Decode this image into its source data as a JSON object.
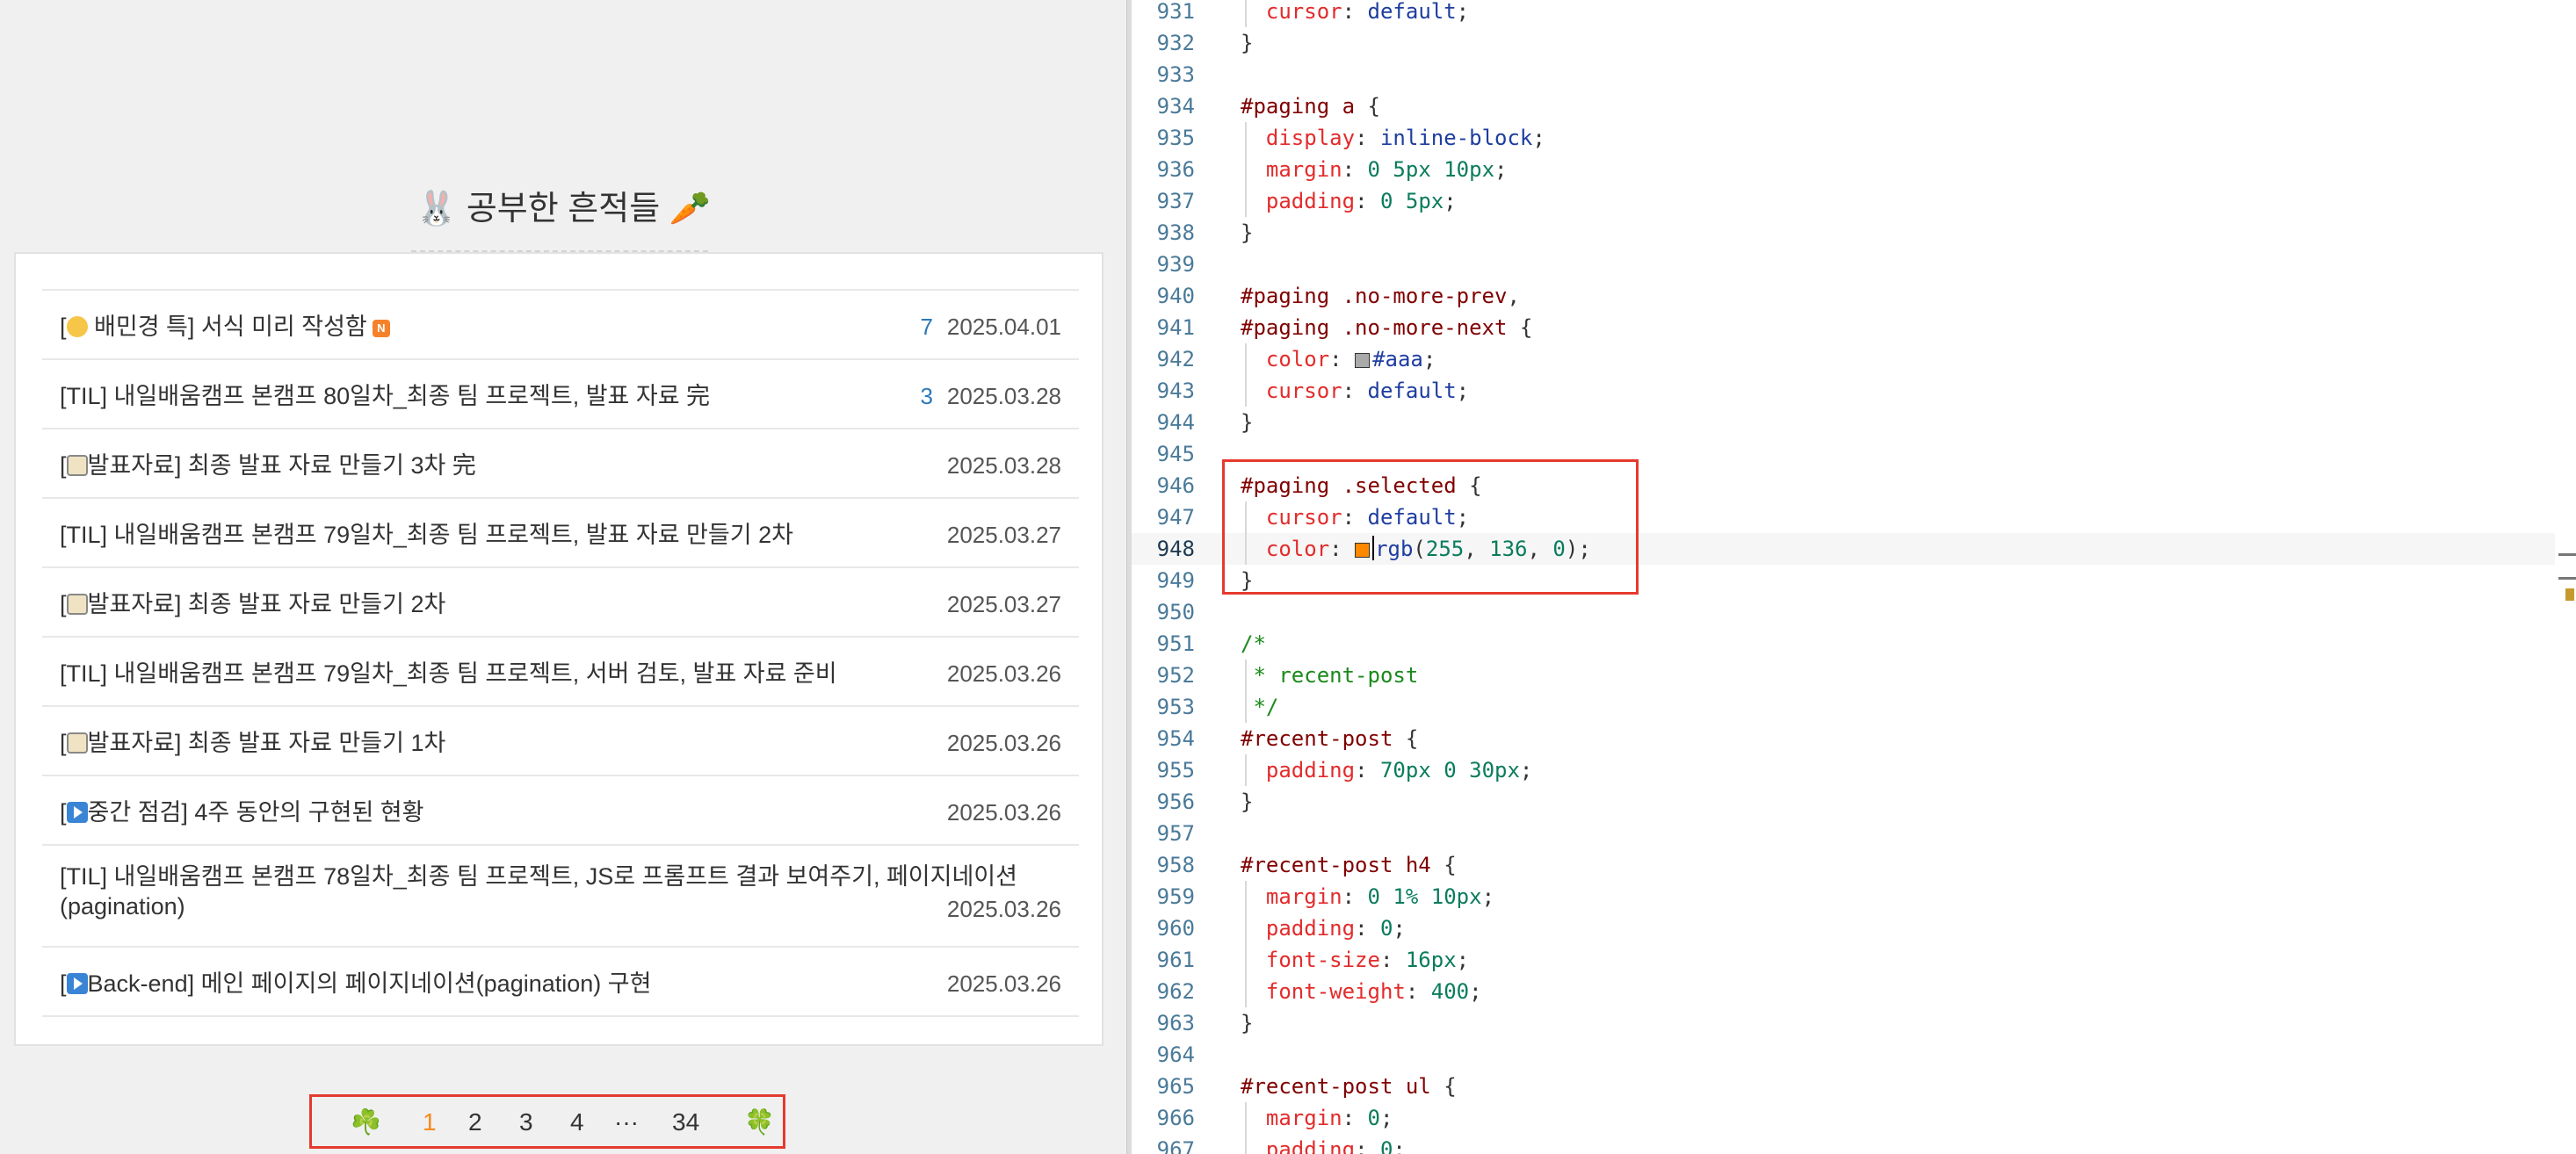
{
  "blog": {
    "section_title": "🐰 공부한 흔적들 🥕",
    "posts": [
      {
        "prefix": "[",
        "emoji": "silly-face",
        "title": " 배민경 특] 서식 미리 작성함",
        "new_badge": "N",
        "count": "7",
        "date": "2025.04.01"
      },
      {
        "prefix": "[TIL] 내일배움캠프 본캠프 80일차_최종 팀 프로젝트, 발표 자료 完",
        "emoji": "",
        "title": "",
        "new_badge": "",
        "count": "3",
        "date": "2025.03.28"
      },
      {
        "prefix": "[",
        "emoji": "clipboard",
        "title": "발표자료] 최종 발표 자료 만들기 3차 完",
        "new_badge": "",
        "count": "",
        "date": "2025.03.28"
      },
      {
        "prefix": "[TIL] 내일배움캠프 본캠프 79일차_최종 팀 프로젝트, 발표 자료 만들기 2차",
        "emoji": "",
        "title": "",
        "new_badge": "",
        "count": "",
        "date": "2025.03.27"
      },
      {
        "prefix": "[",
        "emoji": "clipboard",
        "title": "발표자료] 최종 발표 자료 만들기 2차",
        "new_badge": "",
        "count": "",
        "date": "2025.03.27"
      },
      {
        "prefix": "[TIL] 내일배움캠프 본캠프 79일차_최종 팀 프로젝트, 서버 검토, 발표 자료 준비",
        "emoji": "",
        "title": "",
        "new_badge": "",
        "count": "",
        "date": "2025.03.26"
      },
      {
        "prefix": "[",
        "emoji": "clipboard",
        "title": "발표자료] 최종 발표 자료 만들기 1차",
        "new_badge": "",
        "count": "",
        "date": "2025.03.26"
      },
      {
        "prefix": "[",
        "emoji": "play",
        "title": "중간 점검] 4주 동안의 구현된 현황",
        "new_badge": "",
        "count": "",
        "date": "2025.03.26"
      },
      {
        "prefix": "[TIL] 내일배움캠프 본캠프 78일차_최종 팀 프로젝트, JS로 프롬프트 결과 보여주기, 페이지네이션(pagination)",
        "emoji": "",
        "title": "",
        "new_badge": "",
        "count": "",
        "date": "2025.03.26"
      },
      {
        "prefix": "[",
        "emoji": "play",
        "title": "Back-end] 메인 페이지의 페이지네이션(pagination) 구현",
        "new_badge": "",
        "count": "",
        "date": "2025.03.26"
      }
    ],
    "pagination": {
      "prev_icon": "☘️",
      "pages": [
        "1",
        "2",
        "3",
        "4",
        "···",
        "34"
      ],
      "selected_page": "1",
      "next_icon": "🍀"
    }
  },
  "editor": {
    "colors": {
      "selected_swatch": "#ff8800",
      "aaa_swatch": "#aaaaaa"
    },
    "lines": [
      {
        "n": "931",
        "t": "  cursor: default;"
      },
      {
        "n": "932",
        "t": "}"
      },
      {
        "n": "933",
        "t": ""
      },
      {
        "n": "934",
        "t": "#paging a {"
      },
      {
        "n": "935",
        "t": "  display: inline-block;"
      },
      {
        "n": "936",
        "t": "  margin: 0 5px 10px;"
      },
      {
        "n": "937",
        "t": "  padding: 0 5px;"
      },
      {
        "n": "938",
        "t": "}"
      },
      {
        "n": "939",
        "t": ""
      },
      {
        "n": "940",
        "t": "#paging .no-more-prev,"
      },
      {
        "n": "941",
        "t": "#paging .no-more-next {"
      },
      {
        "n": "942",
        "t": "  color: #aaa;"
      },
      {
        "n": "943",
        "t": "  cursor: default;"
      },
      {
        "n": "944",
        "t": "}"
      },
      {
        "n": "945",
        "t": ""
      },
      {
        "n": "946",
        "t": "#paging .selected {"
      },
      {
        "n": "947",
        "t": "  cursor: default;"
      },
      {
        "n": "948",
        "t": "  color: rgb(255, 136, 0);"
      },
      {
        "n": "949",
        "t": "}"
      },
      {
        "n": "950",
        "t": ""
      },
      {
        "n": "951",
        "t": "/*"
      },
      {
        "n": "952",
        "t": " * recent-post"
      },
      {
        "n": "953",
        "t": " */"
      },
      {
        "n": "954",
        "t": "#recent-post {"
      },
      {
        "n": "955",
        "t": "  padding: 70px 0 30px;"
      },
      {
        "n": "956",
        "t": "}"
      },
      {
        "n": "957",
        "t": ""
      },
      {
        "n": "958",
        "t": "#recent-post h4 {"
      },
      {
        "n": "959",
        "t": "  margin: 0 1% 10px;"
      },
      {
        "n": "960",
        "t": "  padding: 0;"
      },
      {
        "n": "961",
        "t": "  font-size: 16px;"
      },
      {
        "n": "962",
        "t": "  font-weight: 400;"
      },
      {
        "n": "963",
        "t": "}"
      },
      {
        "n": "964",
        "t": ""
      },
      {
        "n": "965",
        "t": "#recent-post ul {"
      },
      {
        "n": "966",
        "t": "  margin: 0;"
      },
      {
        "n": "967",
        "t": "  padding: 0;"
      }
    ]
  }
}
